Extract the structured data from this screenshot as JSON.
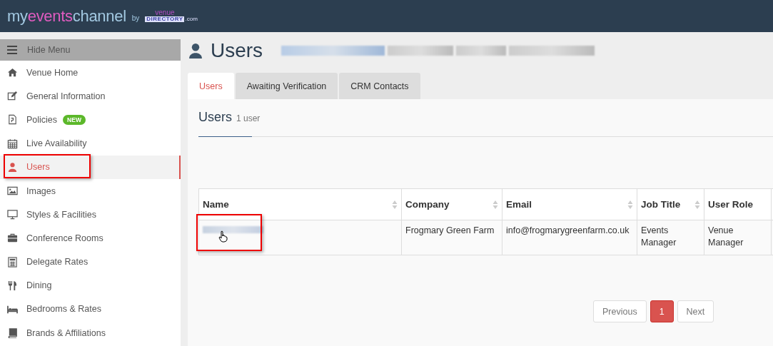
{
  "brand": {
    "parts": [
      {
        "text": "my",
        "accent": false
      },
      {
        "text": "events",
        "accent": true
      },
      {
        "text": "channel",
        "accent": false
      }
    ],
    "by": "by",
    "partner_top": "venue",
    "partner_main": "DIRECTORY",
    "partner_suffix": ".com"
  },
  "sidebar": {
    "toggle": "Hide Menu",
    "items": [
      {
        "label": "Venue Home",
        "kind": "home",
        "selected": false,
        "highlighted": false
      },
      {
        "label": "General Information",
        "kind": "edit",
        "selected": false,
        "highlighted": false
      },
      {
        "label": "Policies",
        "kind": "document",
        "selected": false,
        "highlighted": false,
        "badge": "NEW"
      },
      {
        "label": "Live Availability",
        "kind": "calendar",
        "selected": false,
        "highlighted": false
      },
      {
        "label": "Users",
        "kind": "user",
        "selected": true,
        "highlighted": true
      },
      {
        "label": "Images",
        "kind": "image",
        "selected": false,
        "highlighted": false
      },
      {
        "label": "Styles & Facilities",
        "kind": "monitor",
        "selected": false,
        "highlighted": false
      },
      {
        "label": "Conference Rooms",
        "kind": "briefcase",
        "selected": false,
        "highlighted": false
      },
      {
        "label": "Delegate Rates",
        "kind": "calculator",
        "selected": false,
        "highlighted": false
      },
      {
        "label": "Dining",
        "kind": "cutlery",
        "selected": false,
        "highlighted": false
      },
      {
        "label": "Bedrooms & Rates",
        "kind": "bed",
        "selected": false,
        "highlighted": false
      },
      {
        "label": "Brands & Affiliations",
        "kind": "book",
        "selected": false,
        "highlighted": false
      }
    ]
  },
  "page": {
    "title": "Users"
  },
  "tabs": [
    {
      "label": "Users",
      "selected": true
    },
    {
      "label": "Awaiting Verification",
      "selected": false
    },
    {
      "label": "CRM Contacts",
      "selected": false
    }
  ],
  "panel": {
    "title": "Users",
    "count": "1 user"
  },
  "table": {
    "columns": [
      {
        "label": "Name",
        "sortable": true
      },
      {
        "label": "Company",
        "sortable": true
      },
      {
        "label": "Email",
        "sortable": true
      },
      {
        "label": "Job Title",
        "sortable": true
      },
      {
        "label": "User Role",
        "sortable": false
      }
    ],
    "rows": [
      {
        "name_highlighted": true,
        "company": "Frogmary Green Farm",
        "email": "info@frogmarygreenfarm.co.uk",
        "job_title": "Events Manager",
        "user_role": "Venue Manager"
      }
    ]
  },
  "pagination": {
    "previous": "Previous",
    "pages": [
      {
        "label": "1",
        "selected": true
      }
    ],
    "next": "Next"
  }
}
